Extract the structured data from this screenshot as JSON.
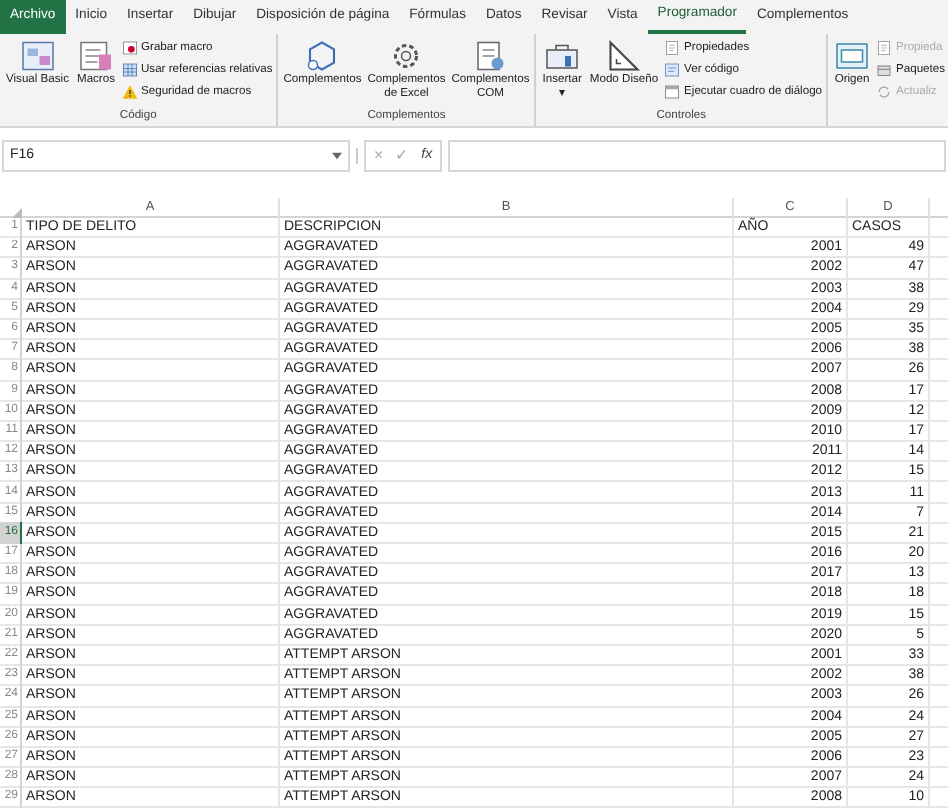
{
  "tabs": [
    {
      "label": "Archivo",
      "kind": "file"
    },
    {
      "label": "Inicio",
      "kind": "tab",
      "selected": false
    },
    {
      "label": "Insertar",
      "kind": "tab",
      "selected": false
    },
    {
      "label": "Dibujar",
      "kind": "tab",
      "selected": false
    },
    {
      "label": "Disposición de página",
      "kind": "tab",
      "selected": false
    },
    {
      "label": "Fórmulas",
      "kind": "tab",
      "selected": false
    },
    {
      "label": "Datos",
      "kind": "tab",
      "selected": false
    },
    {
      "label": "Revisar",
      "kind": "tab",
      "selected": false
    },
    {
      "label": "Vista",
      "kind": "tab",
      "selected": false
    },
    {
      "label": "Programador",
      "kind": "tab",
      "selected": true
    },
    {
      "label": "Complementos",
      "kind": "tab",
      "selected": false
    }
  ],
  "ribbon": {
    "groups": [
      {
        "label": "Código",
        "large": [
          {
            "label": "Visual Basic"
          },
          {
            "label": "Macros"
          }
        ],
        "small": [
          {
            "label": "Grabar macro",
            "disabled": false
          },
          {
            "label": "Usar referencias relativas",
            "disabled": false
          },
          {
            "label": "Seguridad de macros",
            "disabled": false
          }
        ]
      },
      {
        "label": "Complementos",
        "large": [
          {
            "label": "Complementos"
          },
          {
            "label": "Complementos de Excel"
          },
          {
            "label": "Complementos COM"
          }
        ]
      },
      {
        "label": "Controles",
        "large": [
          {
            "label": "Insertar",
            "dropdown": "▾"
          },
          {
            "label": "Modo Diseño"
          }
        ],
        "small": [
          {
            "label": "Propiedades",
            "disabled": false
          },
          {
            "label": "Ver código",
            "disabled": false
          },
          {
            "label": "Ejecutar cuadro de diálogo",
            "disabled": false
          }
        ]
      },
      {
        "large": [
          {
            "label": "Origen"
          }
        ],
        "small": [
          {
            "label": "Propieda",
            "disabled": true
          },
          {
            "label": "Paquetes",
            "disabled": false
          },
          {
            "label": "Actualiz",
            "disabled": true
          }
        ]
      }
    ]
  },
  "formula_bar": {
    "name_box": "F16",
    "cancel": "×",
    "enter": "✓",
    "function": "fx"
  },
  "columns": [
    "A",
    "B",
    "C",
    "D"
  ],
  "rows": [
    {
      "number": "1",
      "kind": "labels",
      "selected": false,
      "cells": [
        "TIPO DE DELITO",
        "DESCRIPCION",
        "AÑO",
        "CASOS"
      ]
    },
    {
      "number": "2",
      "kind": "data",
      "selected": false,
      "cells": [
        "ARSON",
        "AGGRAVATED",
        "2001",
        "49"
      ]
    },
    {
      "number": "3",
      "kind": "data",
      "selected": false,
      "cells": [
        "ARSON",
        "AGGRAVATED",
        "2002",
        "47"
      ]
    },
    {
      "number": "4",
      "kind": "data",
      "selected": false,
      "cells": [
        "ARSON",
        "AGGRAVATED",
        "2003",
        "38"
      ]
    },
    {
      "number": "5",
      "kind": "data",
      "selected": false,
      "cells": [
        "ARSON",
        "AGGRAVATED",
        "2004",
        "29"
      ]
    },
    {
      "number": "6",
      "kind": "data",
      "selected": false,
      "cells": [
        "ARSON",
        "AGGRAVATED",
        "2005",
        "35"
      ]
    },
    {
      "number": "7",
      "kind": "data",
      "selected": false,
      "cells": [
        "ARSON",
        "AGGRAVATED",
        "2006",
        "38"
      ]
    },
    {
      "number": "8",
      "kind": "data",
      "selected": false,
      "cells": [
        "ARSON",
        "AGGRAVATED",
        "2007",
        "26"
      ]
    },
    {
      "number": "9",
      "kind": "data",
      "selected": false,
      "cells": [
        "ARSON",
        "AGGRAVATED",
        "2008",
        "17"
      ]
    },
    {
      "number": "10",
      "kind": "data",
      "selected": false,
      "cells": [
        "ARSON",
        "AGGRAVATED",
        "2009",
        "12"
      ]
    },
    {
      "number": "11",
      "kind": "data",
      "selected": false,
      "cells": [
        "ARSON",
        "AGGRAVATED",
        "2010",
        "17"
      ]
    },
    {
      "number": "12",
      "kind": "data",
      "selected": false,
      "cells": [
        "ARSON",
        "AGGRAVATED",
        "2011",
        "14"
      ]
    },
    {
      "number": "13",
      "kind": "data",
      "selected": false,
      "cells": [
        "ARSON",
        "AGGRAVATED",
        "2012",
        "15"
      ]
    },
    {
      "number": "14",
      "kind": "data",
      "selected": false,
      "cells": [
        "ARSON",
        "AGGRAVATED",
        "2013",
        "11"
      ]
    },
    {
      "number": "15",
      "kind": "data",
      "selected": false,
      "cells": [
        "ARSON",
        "AGGRAVATED",
        "2014",
        "7"
      ]
    },
    {
      "number": "16",
      "kind": "data",
      "selected": true,
      "cells": [
        "ARSON",
        "AGGRAVATED",
        "2015",
        "21"
      ]
    },
    {
      "number": "17",
      "kind": "data",
      "selected": false,
      "cells": [
        "ARSON",
        "AGGRAVATED",
        "2016",
        "20"
      ]
    },
    {
      "number": "18",
      "kind": "data",
      "selected": false,
      "cells": [
        "ARSON",
        "AGGRAVATED",
        "2017",
        "13"
      ]
    },
    {
      "number": "19",
      "kind": "data",
      "selected": false,
      "cells": [
        "ARSON",
        "AGGRAVATED",
        "2018",
        "18"
      ]
    },
    {
      "number": "20",
      "kind": "data",
      "selected": false,
      "cells": [
        "ARSON",
        "AGGRAVATED",
        "2019",
        "15"
      ]
    },
    {
      "number": "21",
      "kind": "data",
      "selected": false,
      "cells": [
        "ARSON",
        "AGGRAVATED",
        "2020",
        "5"
      ]
    },
    {
      "number": "22",
      "kind": "data",
      "selected": false,
      "cells": [
        "ARSON",
        "ATTEMPT ARSON",
        "2001",
        "33"
      ]
    },
    {
      "number": "23",
      "kind": "data",
      "selected": false,
      "cells": [
        "ARSON",
        "ATTEMPT ARSON",
        "2002",
        "38"
      ]
    },
    {
      "number": "24",
      "kind": "data",
      "selected": false,
      "cells": [
        "ARSON",
        "ATTEMPT ARSON",
        "2003",
        "26"
      ]
    },
    {
      "number": "25",
      "kind": "data",
      "selected": false,
      "cells": [
        "ARSON",
        "ATTEMPT ARSON",
        "2004",
        "24"
      ]
    },
    {
      "number": "26",
      "kind": "data",
      "selected": false,
      "cells": [
        "ARSON",
        "ATTEMPT ARSON",
        "2005",
        "27"
      ]
    },
    {
      "number": "27",
      "kind": "data",
      "selected": false,
      "cells": [
        "ARSON",
        "ATTEMPT ARSON",
        "2006",
        "23"
      ]
    },
    {
      "number": "28",
      "kind": "data",
      "selected": false,
      "cells": [
        "ARSON",
        "ATTEMPT ARSON",
        "2007",
        "24"
      ]
    },
    {
      "number": "29",
      "kind": "data",
      "selected": false,
      "cells": [
        "ARSON",
        "ATTEMPT ARSON",
        "2008",
        "10"
      ]
    }
  ]
}
